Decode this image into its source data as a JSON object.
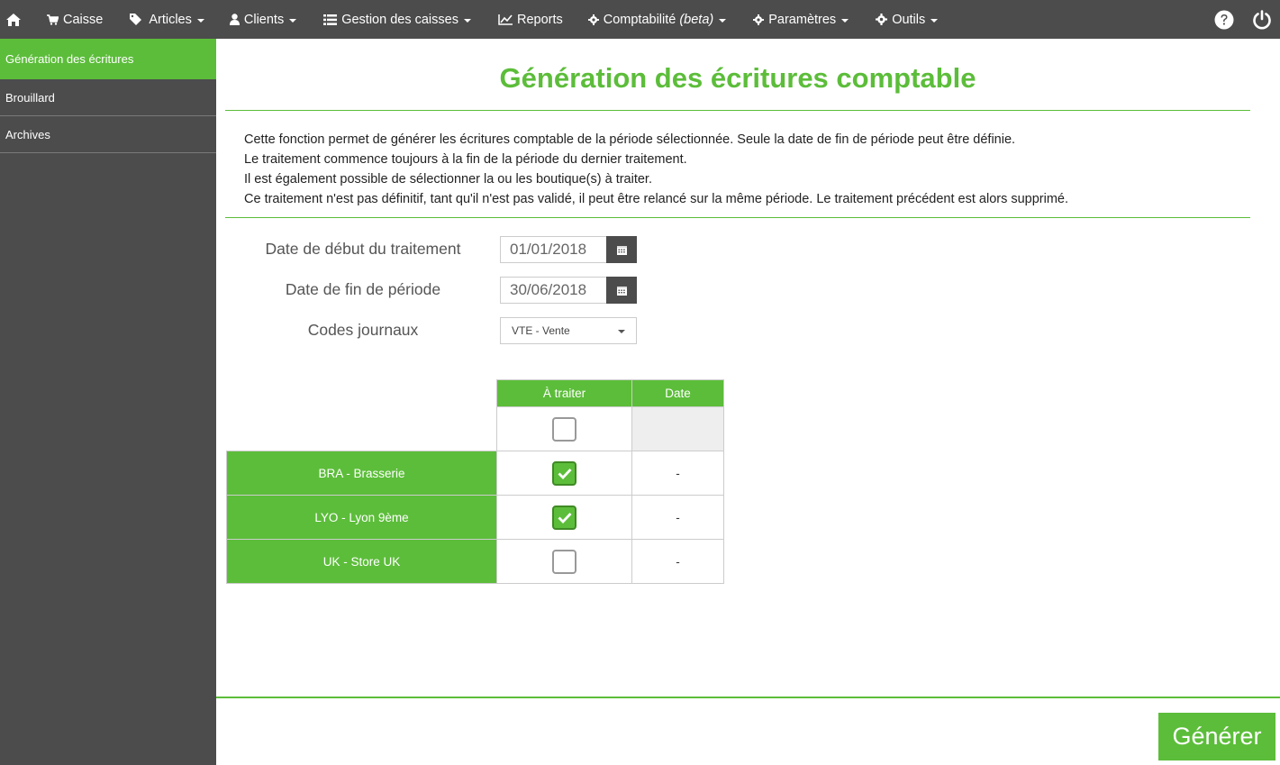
{
  "navbar": {
    "items": [
      {
        "label": "Caisse",
        "icon": "cart-icon",
        "dropdown": false
      },
      {
        "label": "Articles",
        "icon": "tags-icon",
        "dropdown": true
      },
      {
        "label": "Clients",
        "icon": "user-icon",
        "dropdown": true
      },
      {
        "label": "Gestion des caisses",
        "icon": "list-icon",
        "dropdown": true
      },
      {
        "label": "Reports",
        "icon": "chart-icon",
        "dropdown": false
      },
      {
        "label": "Comptabilité",
        "suffix": "(beta)",
        "icon": "gear-icon",
        "dropdown": true
      },
      {
        "label": "Paramètres",
        "icon": "gear-icon",
        "dropdown": true
      },
      {
        "label": "Outils",
        "icon": "gear-icon",
        "dropdown": true
      }
    ]
  },
  "sidebar": {
    "items": [
      {
        "label": "Génération des écritures",
        "active": true
      },
      {
        "label": "Brouillard",
        "active": false
      },
      {
        "label": "Archives",
        "active": false
      }
    ]
  },
  "main": {
    "title": "Génération des écritures comptable",
    "description": [
      "Cette fonction permet de générer les écritures comptable de la période sélectionnée. Seule la date de fin de période peut être définie.",
      "Le traitement commence toujours à la fin de la période du dernier traitement.",
      "Il est également possible de sélectionner la ou les boutique(s) à traiter.",
      "Ce traitement n'est pas définitif, tant qu'il n'est pas validé, il peut être relancé sur la même période. Le traitement précédent est alors supprimé."
    ],
    "form": {
      "start_label": "Date de début du traitement",
      "start_value": "01/01/2018",
      "end_label": "Date de fin de période",
      "end_value": "30/06/2018",
      "journal_label": "Codes journaux",
      "journal_value": "VTE - Vente"
    },
    "table": {
      "headers": [
        "À traiter",
        "Date"
      ],
      "select_all_checked": false,
      "rows": [
        {
          "name": "BRA - Brasserie",
          "checked": true,
          "date": "-"
        },
        {
          "name": "LYO - Lyon 9ème",
          "checked": true,
          "date": "-"
        },
        {
          "name": "UK - Store UK",
          "checked": false,
          "date": "-"
        }
      ]
    },
    "generate_label": "Générer"
  },
  "colors": {
    "accent": "#5cbd3a",
    "nav_bg": "#4c4c4c"
  }
}
